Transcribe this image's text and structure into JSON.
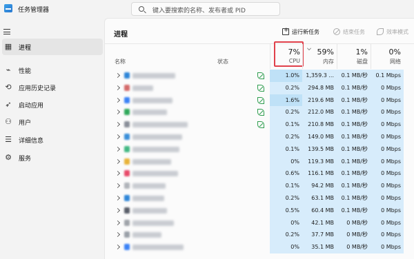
{
  "app": {
    "title": "任务管理器",
    "icon": "task-manager-icon"
  },
  "search": {
    "placeholder": "键入要搜索的名称、发布者或 PID",
    "icon": "search-icon"
  },
  "sidebar": {
    "items": [
      {
        "label": "进程",
        "icon": "processes-icon",
        "glyph": "▦",
        "active": true
      },
      {
        "label": "性能",
        "icon": "performance-icon",
        "glyph": "⌁",
        "active": false
      },
      {
        "label": "应用历史记录",
        "icon": "history-icon",
        "glyph": "⟲",
        "active": false
      },
      {
        "label": "启动应用",
        "icon": "startup-icon",
        "glyph": "➶",
        "active": false
      },
      {
        "label": "用户",
        "icon": "users-icon",
        "glyph": "⚇",
        "active": false
      },
      {
        "label": "详细信息",
        "icon": "details-icon",
        "glyph": "☰",
        "active": false
      },
      {
        "label": "服务",
        "icon": "services-icon",
        "glyph": "⚙",
        "active": false
      }
    ]
  },
  "main": {
    "title": "进程",
    "toolbar": {
      "run_new_task": "运行新任务",
      "end_task": "结束任务",
      "efficiency_mode": "效率模式"
    },
    "columns": {
      "name": "名称",
      "status": "状态",
      "cpu": {
        "pct": "7%",
        "label": "CPU"
      },
      "memory": {
        "pct": "59%",
        "label": "内存"
      },
      "disk": {
        "pct": "1%",
        "label": "磁盘"
      },
      "network": {
        "pct": "0%",
        "label": "网络"
      }
    },
    "rows": [
      {
        "cpu": "1.0%",
        "mem": "1,359.3 ...",
        "disk": "0.1 MB/秒",
        "net": "0.1 Mbps",
        "leaf": true,
        "icon_color": "#2f86d8"
      },
      {
        "cpu": "0.2%",
        "mem": "294.8 MB",
        "disk": "0.1 MB/秒",
        "net": "0 Mbps",
        "leaf": true,
        "icon_color": "#d46a6a"
      },
      {
        "cpu": "1.6%",
        "mem": "219.6 MB",
        "disk": "0.1 MB/秒",
        "net": "0 Mbps",
        "leaf": true,
        "icon_color": "#3b82f6"
      },
      {
        "cpu": "0.2%",
        "mem": "212.0 MB",
        "disk": "0.1 MB/秒",
        "net": "0 Mbps",
        "leaf": true,
        "icon_color": "#2fa85a"
      },
      {
        "cpu": "0.1%",
        "mem": "210.8 MB",
        "disk": "0.1 MB/秒",
        "net": "0 Mbps",
        "leaf": true,
        "icon_color": "#8a8f99"
      },
      {
        "cpu": "0.2%",
        "mem": "149.0 MB",
        "disk": "0.1 MB/秒",
        "net": "0 Mbps",
        "leaf": false,
        "icon_color": "#3a8fd9"
      },
      {
        "cpu": "0.1%",
        "mem": "139.5 MB",
        "disk": "0.1 MB/秒",
        "net": "0 Mbps",
        "leaf": false,
        "icon_color": "#42b883"
      },
      {
        "cpu": "0%",
        "mem": "119.3 MB",
        "disk": "0.1 MB/秒",
        "net": "0 Mbps",
        "leaf": false,
        "icon_color": "#e8b339"
      },
      {
        "cpu": "0.6%",
        "mem": "116.1 MB",
        "disk": "0.1 MB/秒",
        "net": "0 Mbps",
        "leaf": false,
        "icon_color": "#e84b6a"
      },
      {
        "cpu": "0.1%",
        "mem": "94.2 MB",
        "disk": "0.1 MB/秒",
        "net": "0 Mbps",
        "leaf": false,
        "icon_color": "#b0b4ba"
      },
      {
        "cpu": "0.2%",
        "mem": "63.1 MB",
        "disk": "0.1 MB/秒",
        "net": "0 Mbps",
        "leaf": false,
        "icon_color": "#2f86d8"
      },
      {
        "cpu": "0.5%",
        "mem": "60.4 MB",
        "disk": "0.1 MB/秒",
        "net": "0 Mbps",
        "leaf": false,
        "icon_color": "#5a5f6a"
      },
      {
        "cpu": "0%",
        "mem": "42.1 MB",
        "disk": "0 MB/秒",
        "net": "0 Mbps",
        "leaf": false,
        "icon_color": "#a0a4aa"
      },
      {
        "cpu": "0.2%",
        "mem": "37.7 MB",
        "disk": "0 MB/秒",
        "net": "0 Mbps",
        "leaf": false,
        "icon_color": "#9aa0a8"
      },
      {
        "cpu": "0%",
        "mem": "35.1 MB",
        "disk": "0 MB/秒",
        "net": "0 Mbps",
        "leaf": false,
        "icon_color": "#3b82f6"
      }
    ]
  },
  "colors": {
    "heat_light": "#d7ecfb",
    "heat_medium": "#bfe1f7",
    "cpu_highlight": "#e0404a",
    "green_leaf": "#2e9d4e"
  }
}
